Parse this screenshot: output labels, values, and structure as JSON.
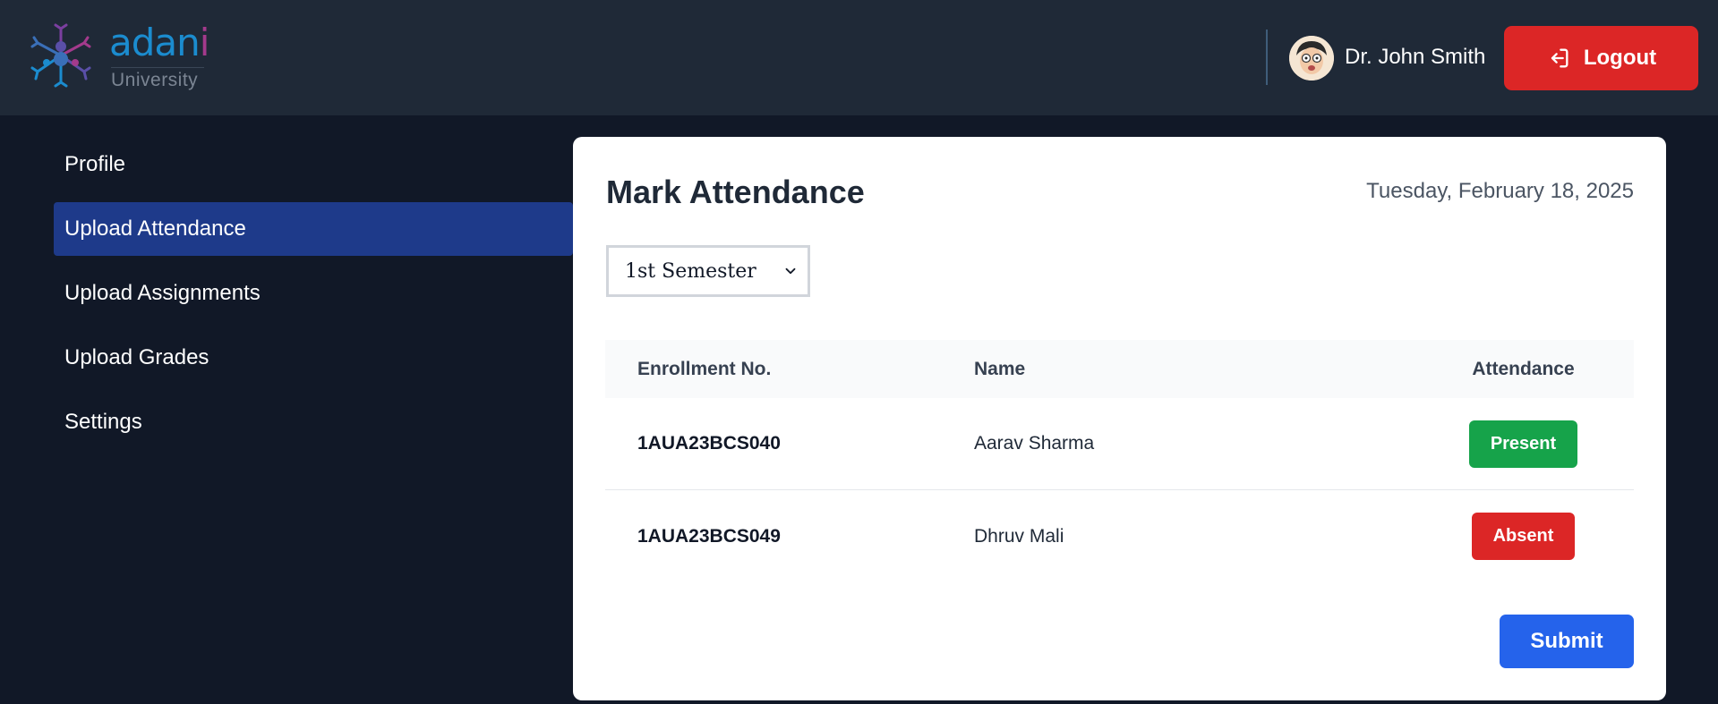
{
  "header": {
    "logo": {
      "word": "adan",
      "word_accent": "i",
      "subtitle": "University"
    },
    "user": {
      "name": "Dr. John Smith",
      "avatar_icon": "avatar-icon"
    },
    "logout": {
      "label": "Logout",
      "icon": "logout-icon"
    }
  },
  "sidebar": {
    "items": [
      {
        "label": "Profile",
        "active": false
      },
      {
        "label": "Upload Attendance",
        "active": true
      },
      {
        "label": "Upload Assignments",
        "active": false
      },
      {
        "label": "Upload Grades",
        "active": false
      },
      {
        "label": "Settings",
        "active": false
      }
    ]
  },
  "main": {
    "title": "Mark Attendance",
    "date": "Tuesday, February 18, 2025",
    "semester_select": {
      "value": "1st Semester"
    },
    "table": {
      "headers": [
        "Enrollment No.",
        "Name",
        "Attendance"
      ],
      "rows": [
        {
          "enrollment": "1AUA23BCS040",
          "name": "Aarav Sharma",
          "status": "Present",
          "status_color": "#16a34a"
        },
        {
          "enrollment": "1AUA23BCS049",
          "name": "Dhruv Mali",
          "status": "Absent",
          "status_color": "#dc2626"
        }
      ]
    },
    "submit_label": "Submit"
  },
  "colors": {
    "header_bg": "#1f2937",
    "page_bg": "#111827",
    "active_nav": "#1e3a8a",
    "logout": "#dc2626",
    "submit": "#2563eb"
  }
}
